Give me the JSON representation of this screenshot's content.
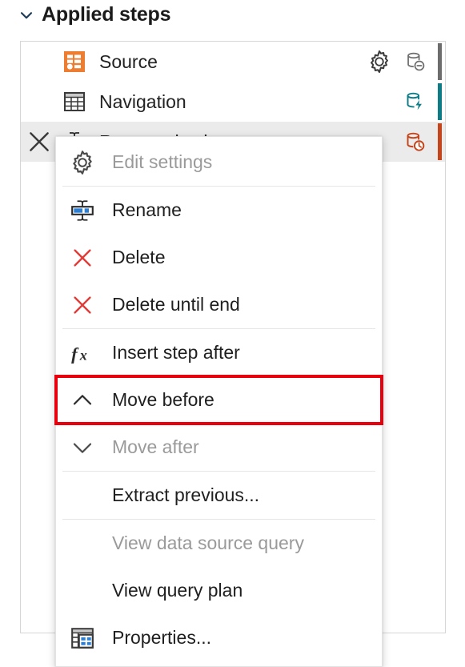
{
  "header": {
    "title": "Applied steps",
    "chevron_icon": "chevron-down-icon",
    "expanded": true
  },
  "colors": {
    "source_orange": "#ED7D31",
    "fold_gray": "#6D6D6D",
    "fold_teal": "#0E7C86",
    "fold_red": "#C4451C",
    "highlight_red": "#E8000D",
    "selected_row_bg": "#EBEBEB",
    "accent_blue": "#2A7FD4"
  },
  "steps": {
    "items": [
      {
        "label": "Source",
        "icon": "source-icon",
        "selected": false,
        "show_delete": false,
        "show_gear": true,
        "fold_icon": "database-minus-icon",
        "fold_status": "not-folded",
        "fold_color": "#6D6D6D"
      },
      {
        "label": "Navigation",
        "icon": "table-icon",
        "selected": false,
        "show_delete": false,
        "show_gear": false,
        "fold_icon": "database-lightning-icon",
        "fold_status": "folded",
        "fold_color": "#0E7C86"
      },
      {
        "label": "Renamed columns",
        "icon": "rename-columns-icon",
        "selected": true,
        "show_delete": true,
        "show_gear": false,
        "fold_icon": "database-clock-icon",
        "fold_status": "pending",
        "fold_color": "#C4451C"
      }
    ],
    "delete_icon": "close-x-icon",
    "gear_icon": "gear-icon"
  },
  "context_menu": {
    "groups": [
      {
        "items": [
          {
            "label": "Edit settings",
            "icon": "gear-icon",
            "disabled": true,
            "highlighted": false
          }
        ]
      },
      {
        "items": [
          {
            "label": "Rename",
            "icon": "rename-icon",
            "disabled": false,
            "highlighted": false
          },
          {
            "label": "Delete",
            "icon": "delete-x-icon",
            "disabled": false,
            "highlighted": false
          },
          {
            "label": "Delete until end",
            "icon": "delete-x-icon",
            "disabled": false,
            "highlighted": false
          }
        ]
      },
      {
        "items": [
          {
            "label": "Insert step after",
            "icon": "fx-icon",
            "disabled": false,
            "highlighted": false
          },
          {
            "label": "Move before",
            "icon": "chevron-up-icon",
            "disabled": false,
            "highlighted": true
          },
          {
            "label": "Move after",
            "icon": "chevron-down-icon",
            "disabled": true,
            "highlighted": false
          }
        ]
      },
      {
        "items": [
          {
            "label": "Extract previous...",
            "icon": "none",
            "disabled": false,
            "highlighted": false
          }
        ]
      },
      {
        "items": [
          {
            "label": "View data source query",
            "icon": "none",
            "disabled": true,
            "highlighted": false
          },
          {
            "label": "View query plan",
            "icon": "none",
            "disabled": false,
            "highlighted": false
          },
          {
            "label": "Properties...",
            "icon": "properties-icon",
            "disabled": false,
            "highlighted": false
          }
        ]
      }
    ]
  }
}
